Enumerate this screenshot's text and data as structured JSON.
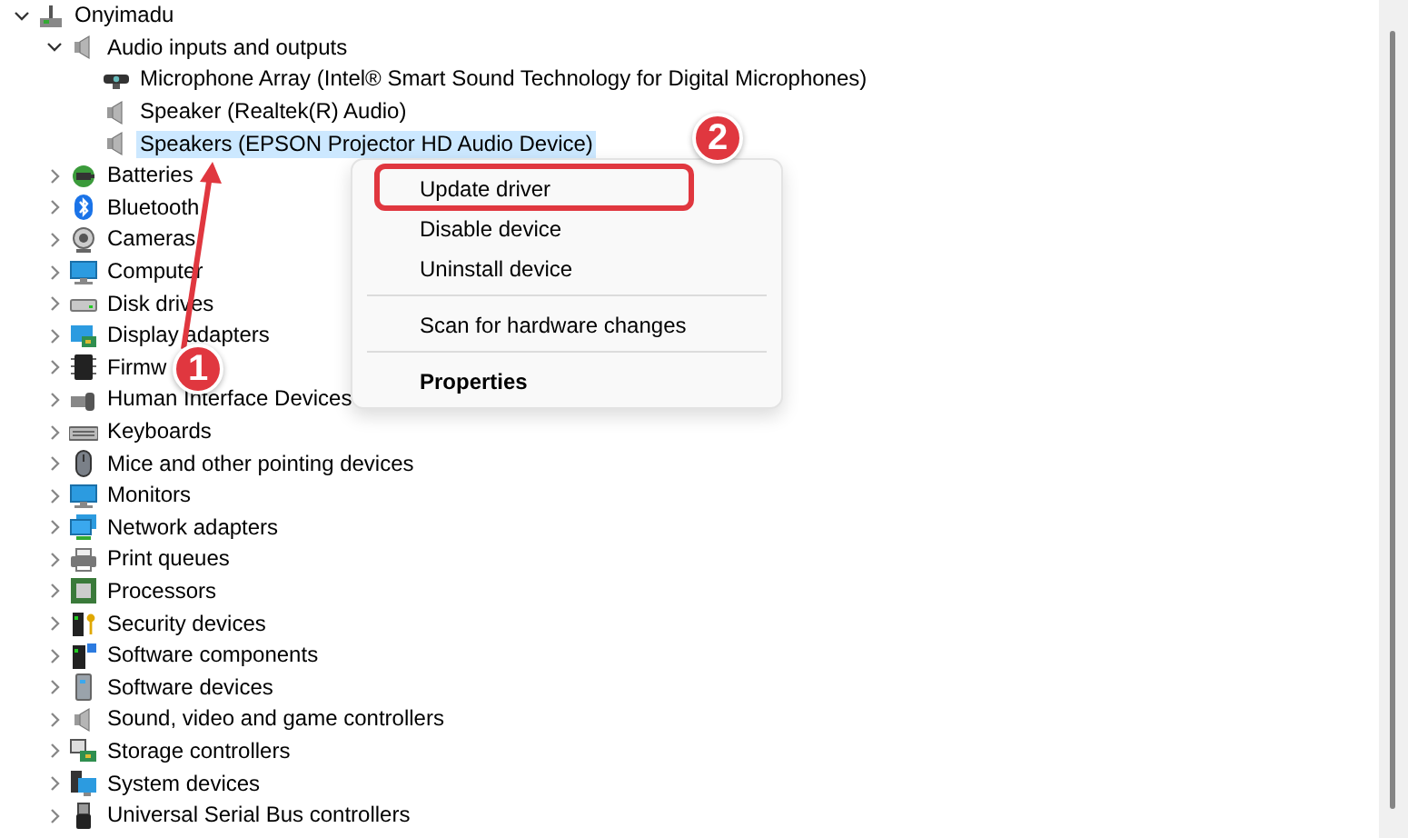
{
  "tree": {
    "label": "Onyimadu",
    "expanded": true,
    "selected": false,
    "children": [
      {
        "label": "Audio inputs and outputs",
        "expanded": true,
        "selected": false,
        "children": [
          {
            "label": "Microphone Array (Intel® Smart Sound Technology for Digital Microphones)",
            "selected": false
          },
          {
            "label": "Speaker (Realtek(R) Audio)",
            "selected": false
          },
          {
            "label": "Speakers (EPSON Projector HD Audio Device)",
            "selected": true
          }
        ]
      },
      {
        "label": "Batteries",
        "expanded": false,
        "selected": false
      },
      {
        "label": "Bluetooth",
        "expanded": false,
        "selected": false
      },
      {
        "label": "Cameras",
        "expanded": false,
        "selected": false
      },
      {
        "label": "Computer",
        "expanded": false,
        "selected": false
      },
      {
        "label": "Disk drives",
        "expanded": false,
        "selected": false
      },
      {
        "label": "Display adapters",
        "expanded": false,
        "selected": false
      },
      {
        "label": "Firmw",
        "expanded": false,
        "selected": false
      },
      {
        "label": "Human Interface Devices",
        "expanded": false,
        "selected": false
      },
      {
        "label": "Keyboards",
        "expanded": false,
        "selected": false
      },
      {
        "label": "Mice and other pointing devices",
        "expanded": false,
        "selected": false
      },
      {
        "label": "Monitors",
        "expanded": false,
        "selected": false
      },
      {
        "label": "Network adapters",
        "expanded": false,
        "selected": false
      },
      {
        "label": "Print queues",
        "expanded": false,
        "selected": false
      },
      {
        "label": "Processors",
        "expanded": false,
        "selected": false
      },
      {
        "label": "Security devices",
        "expanded": false,
        "selected": false
      },
      {
        "label": "Software components",
        "expanded": false,
        "selected": false
      },
      {
        "label": "Software devices",
        "expanded": false,
        "selected": false
      },
      {
        "label": "Sound, video and game controllers",
        "expanded": false,
        "selected": false
      },
      {
        "label": "Storage controllers",
        "expanded": false,
        "selected": false
      },
      {
        "label": "System devices",
        "expanded": false,
        "selected": false
      },
      {
        "label": "Universal Serial Bus controllers",
        "expanded": false,
        "selected": false
      }
    ]
  },
  "context_menu": [
    {
      "kind": "item",
      "label": "Update driver",
      "highlighted": true,
      "default": false
    },
    {
      "kind": "item",
      "label": "Disable device",
      "highlighted": false,
      "default": false
    },
    {
      "kind": "item",
      "label": "Uninstall device",
      "highlighted": false,
      "default": false
    },
    {
      "kind": "separator"
    },
    {
      "kind": "item",
      "label": "Scan for hardware changes",
      "highlighted": false,
      "default": false
    },
    {
      "kind": "separator"
    },
    {
      "kind": "item",
      "label": "Properties",
      "highlighted": false,
      "default": true
    }
  ],
  "annotations": [
    {
      "label": "1"
    },
    {
      "label": "2"
    }
  ]
}
